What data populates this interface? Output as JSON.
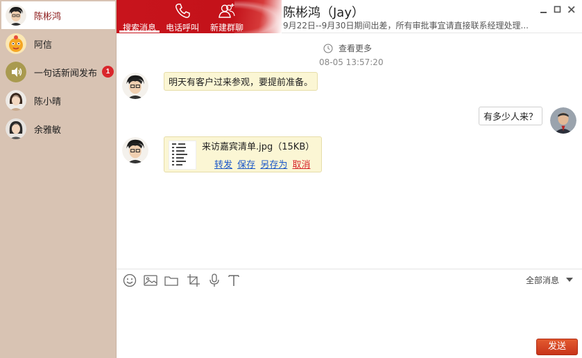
{
  "sidebar": {
    "contacts": [
      {
        "name": "陈彬鸿",
        "avatar": "young-man-avatar",
        "active": true
      },
      {
        "name": "阿信",
        "avatar": "cartoon-avatar",
        "active": false
      },
      {
        "name": "一句话新闻发布",
        "avatar": "speaker-avatar",
        "active": false,
        "unread": "1"
      },
      {
        "name": "陈小晴",
        "avatar": "woman-avatar",
        "active": false
      },
      {
        "name": "余雅敏",
        "avatar": "woman-avatar-2",
        "active": false
      }
    ]
  },
  "header": {
    "tabs": [
      {
        "label": "搜索消息",
        "icon": "search-icon"
      },
      {
        "label": "电话呼叫",
        "icon": "phone-icon"
      },
      {
        "label": "新建群聊",
        "icon": "add-group-icon"
      }
    ],
    "title": "陈彬鸿（Jay）",
    "subtitle": "9月22日--9月30日期间出差，所有审批事宜请直接联系经理处理...",
    "window_buttons": [
      "minimize-icon",
      "maximize-icon",
      "close-icon"
    ]
  },
  "chat": {
    "view_more": "查看更多",
    "timestamp": "08-05 13:57:20",
    "messages": [
      {
        "side": "left",
        "text": "明天有客户过来参观，要提前准备。"
      },
      {
        "side": "right",
        "text": "有多少人来？"
      },
      {
        "side": "left",
        "file": {
          "name": "来访嘉宾清单.jpg（15KB）",
          "actions": {
            "forward": "转发",
            "save": "保存",
            "save_as": "另存为",
            "cancel": "取消"
          }
        }
      }
    ]
  },
  "toolbar": {
    "tools": [
      "emoji-icon",
      "image-icon",
      "folder-icon",
      "screenshot-icon",
      "microphone-icon",
      "font-icon"
    ],
    "all_messages": "全部消息"
  },
  "input": {
    "placeholder": "",
    "value": ""
  },
  "send_label": "发送",
  "colors": {
    "accent": "#c8141c",
    "sidebar": "#d8c3b3",
    "bubble": "#fbf6d4",
    "send": "#d2421f"
  }
}
